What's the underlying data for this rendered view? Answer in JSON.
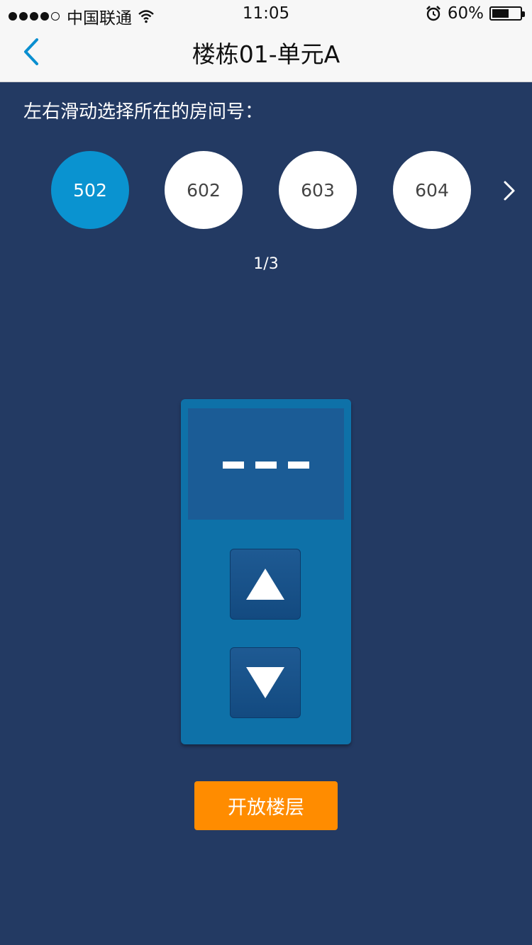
{
  "status_bar": {
    "carrier": "中国联通",
    "time": "11:05",
    "battery_percent": "60%",
    "battery_level": 0.6,
    "icons": [
      "signal-dots-icon",
      "wifi-icon",
      "alarm-icon",
      "battery-icon"
    ]
  },
  "nav": {
    "title": "楼栋01-单元A",
    "back_icon": "chevron-left-icon"
  },
  "hint": "左右滑动选择所在的房间号：",
  "rooms": [
    {
      "label": "502",
      "selected": true
    },
    {
      "label": "602",
      "selected": false
    },
    {
      "label": "603",
      "selected": false
    },
    {
      "label": "604",
      "selected": false
    }
  ],
  "pager": "1/3",
  "elevator": {
    "display_value": "---",
    "up_icon": "triangle-up-icon",
    "down_icon": "triangle-down-icon"
  },
  "open_floor_label": "开放楼层",
  "colors": {
    "background": "#233a63",
    "room_selected": "#0a93d0",
    "panel": "#0e71a8",
    "accent_button": "#ff8c00",
    "nav_tint": "#0a8fd0"
  }
}
